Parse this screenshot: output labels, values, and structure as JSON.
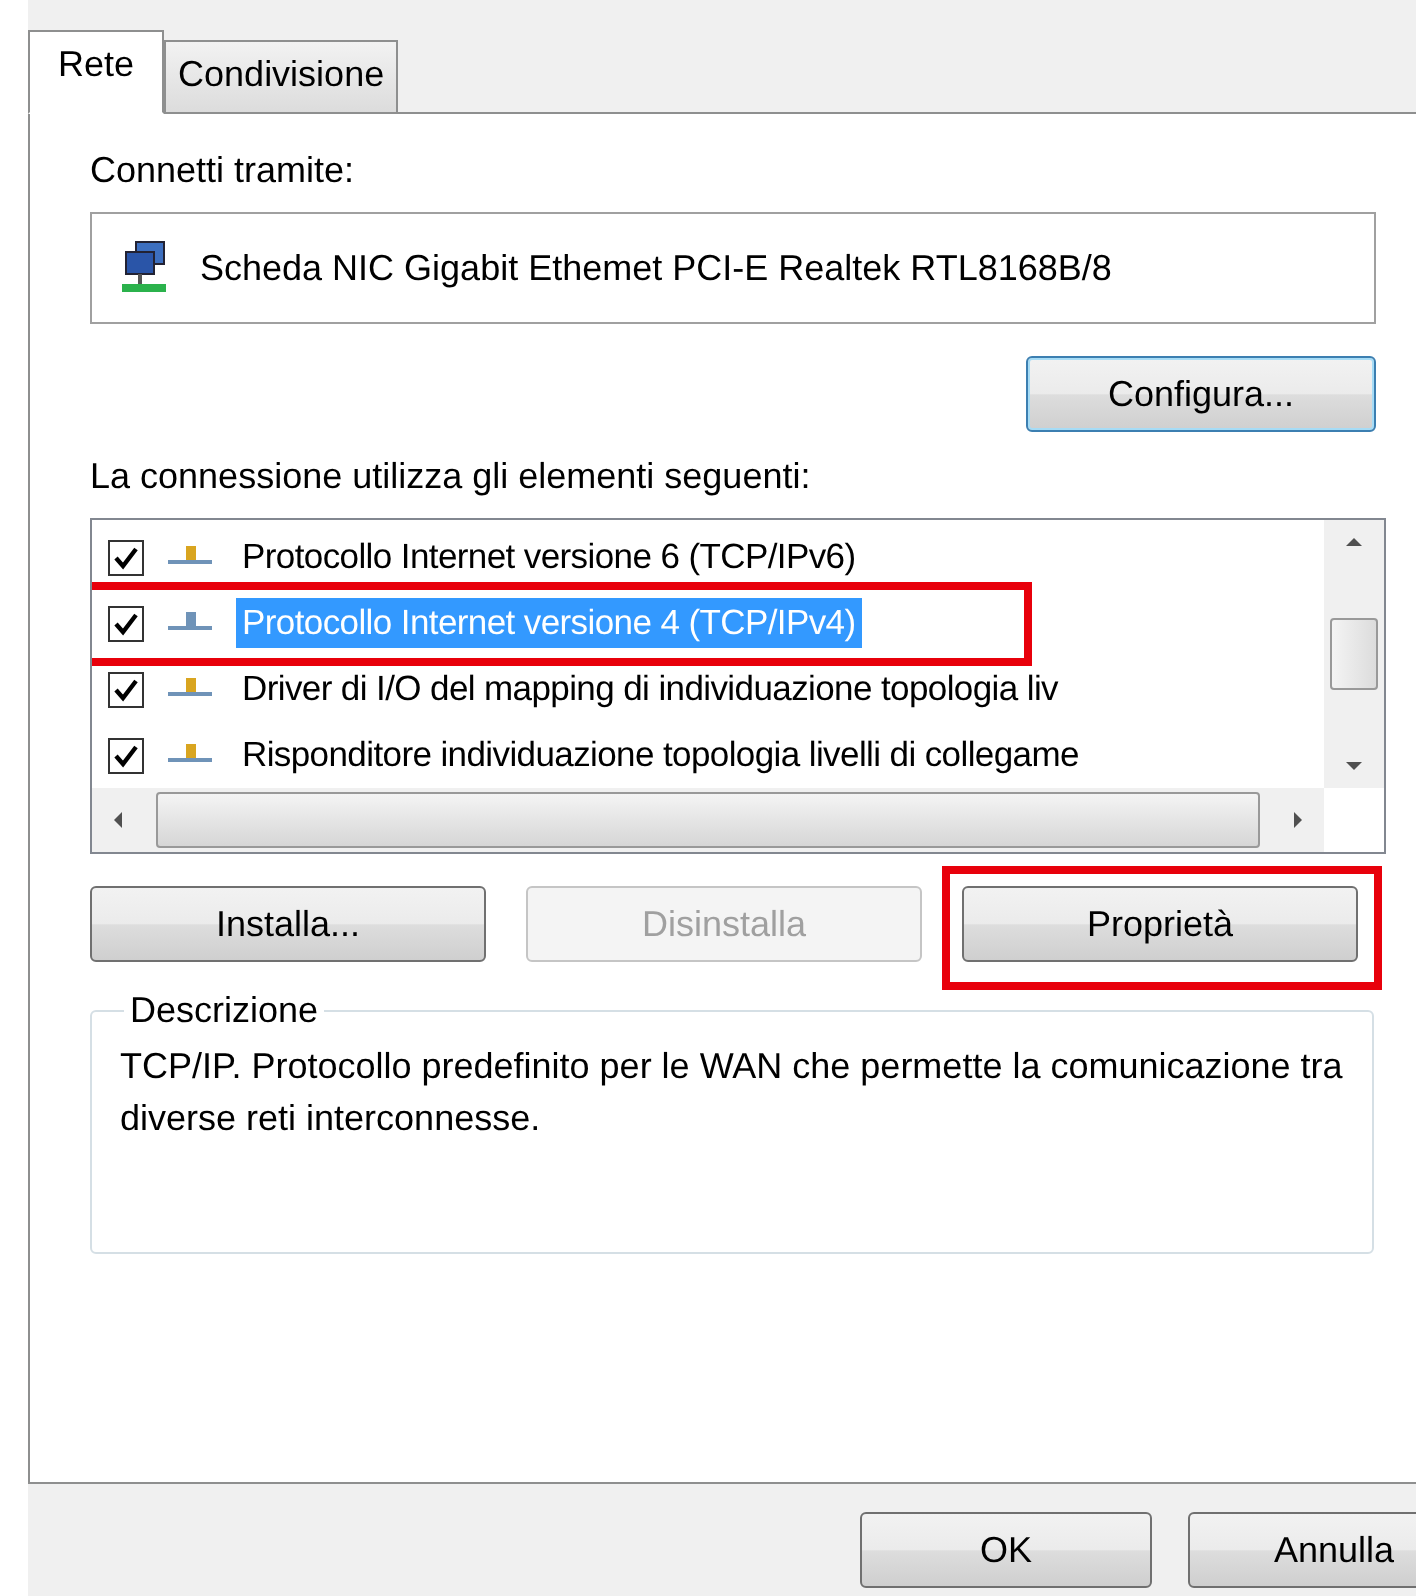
{
  "tabs": [
    {
      "label": "Rete",
      "selected": true
    },
    {
      "label": "Condivisione",
      "selected": false
    }
  ],
  "connect_label": "Connetti tramite:",
  "adapter": "Scheda NIC Gigabit Ethemet PCI-E Realtek RTL8168B/8",
  "configure_button": "Configura...",
  "items_label": "La connessione utilizza gli elementi seguenti:",
  "items": [
    {
      "label": "Protocollo Internet versione 6 (TCP/IPv6)",
      "checked": true,
      "selected": false,
      "highlighted": false
    },
    {
      "label": "Protocollo Internet versione 4 (TCP/IPv4)",
      "checked": true,
      "selected": true,
      "highlighted": true
    },
    {
      "label": "Driver di I/O del mapping di individuazione topologia liv",
      "checked": true,
      "selected": false,
      "highlighted": false
    },
    {
      "label": "Risponditore individuazione topologia livelli di collegame",
      "checked": true,
      "selected": false,
      "highlighted": false
    }
  ],
  "action_buttons": [
    {
      "label": "Installa...",
      "disabled": false,
      "highlighted": false
    },
    {
      "label": "Disinstalla",
      "disabled": true,
      "highlighted": false
    },
    {
      "label": "Proprietà",
      "disabled": false,
      "highlighted": true
    }
  ],
  "description": {
    "title": "Descrizione",
    "text": "TCP/IP. Protocollo predefinito per le WAN che permette la comunicazione tra diverse reti interconnesse."
  },
  "footer_buttons": [
    "OK",
    "Annulla"
  ]
}
